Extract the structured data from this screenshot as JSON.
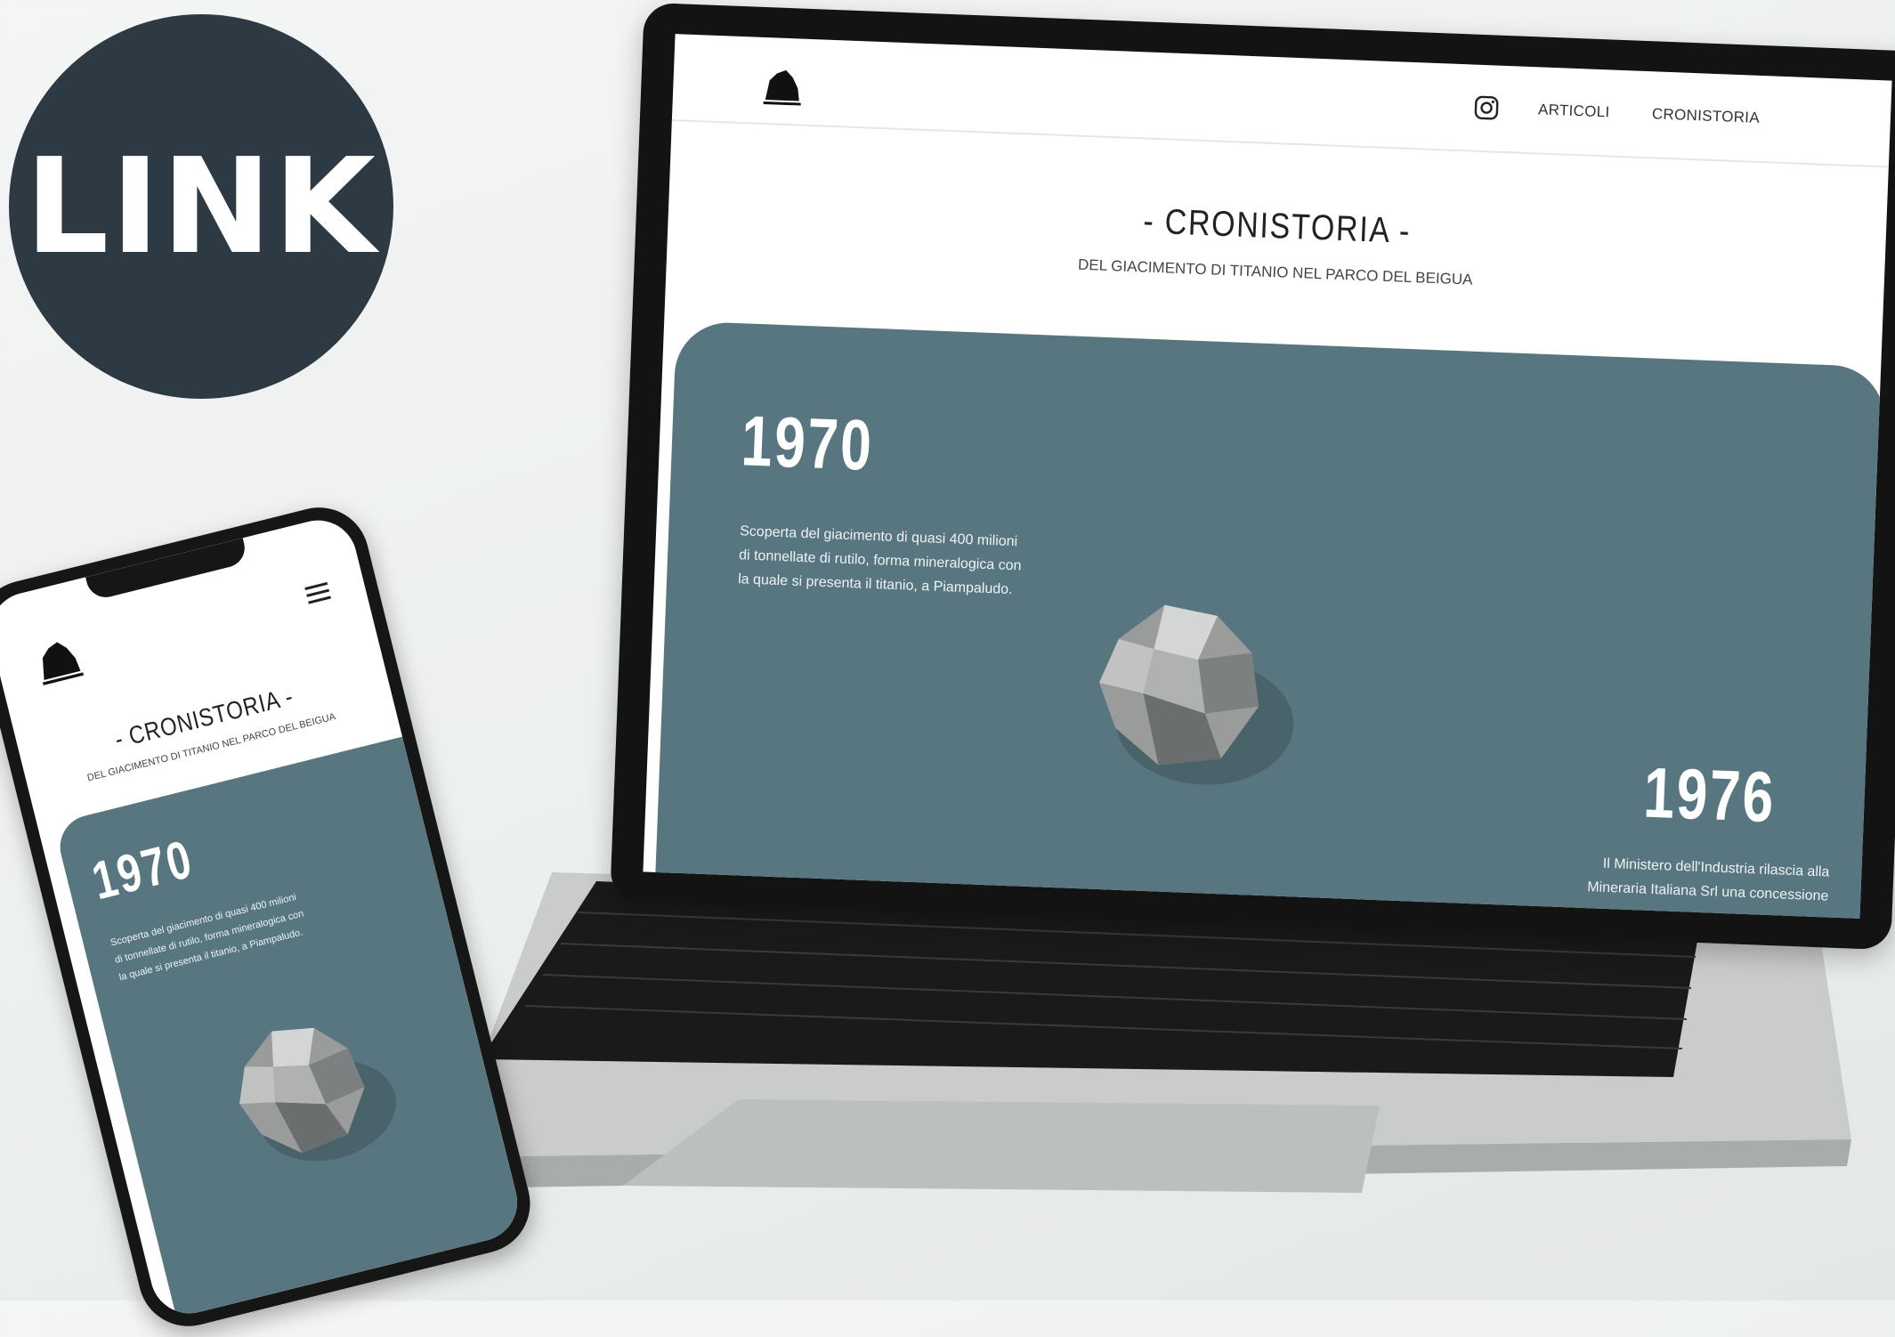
{
  "badge": {
    "label": "LINK",
    "color": "#2d3a44"
  },
  "laptop": {
    "nav": {
      "instagram_icon": "instagram-icon",
      "items": [
        "ARTICOLI",
        "CRONISTORIA"
      ]
    },
    "hero": {
      "title": "- CRONISTORIA -",
      "subtitle": "DEL GIACIMENTO DI TITANIO NEL PARCO DEL BEIGUA"
    },
    "entries": [
      {
        "year": "1970",
        "lines": [
          "Scoperta del giacimento di quasi 400 milioni",
          "di tonnellate di rutilo, forma mineralogica con",
          "la quale si presenta il titanio, a Piampaludo."
        ]
      },
      {
        "year": "1976",
        "lines": [
          "Il Ministero dell'Industria rilascia alla",
          "Mineraria Italiana Srl una concessione"
        ]
      }
    ]
  },
  "phone": {
    "menu_icon": "hamburger-icon",
    "hero": {
      "title": "- CRONISTORIA -",
      "subtitle": "DEL GIACIMENTO DI TITANIO NEL PARCO DEL BEIGUA"
    },
    "entry": {
      "year": "1970",
      "lines": [
        "Scoperta del giacimento di quasi 400 milioni",
        "di tonnellate di rutilo, forma mineralogica con",
        "la quale si presenta il titanio, a Piampaludo."
      ]
    }
  },
  "colors": {
    "panel": "#587680",
    "badge": "#2d3a44"
  }
}
